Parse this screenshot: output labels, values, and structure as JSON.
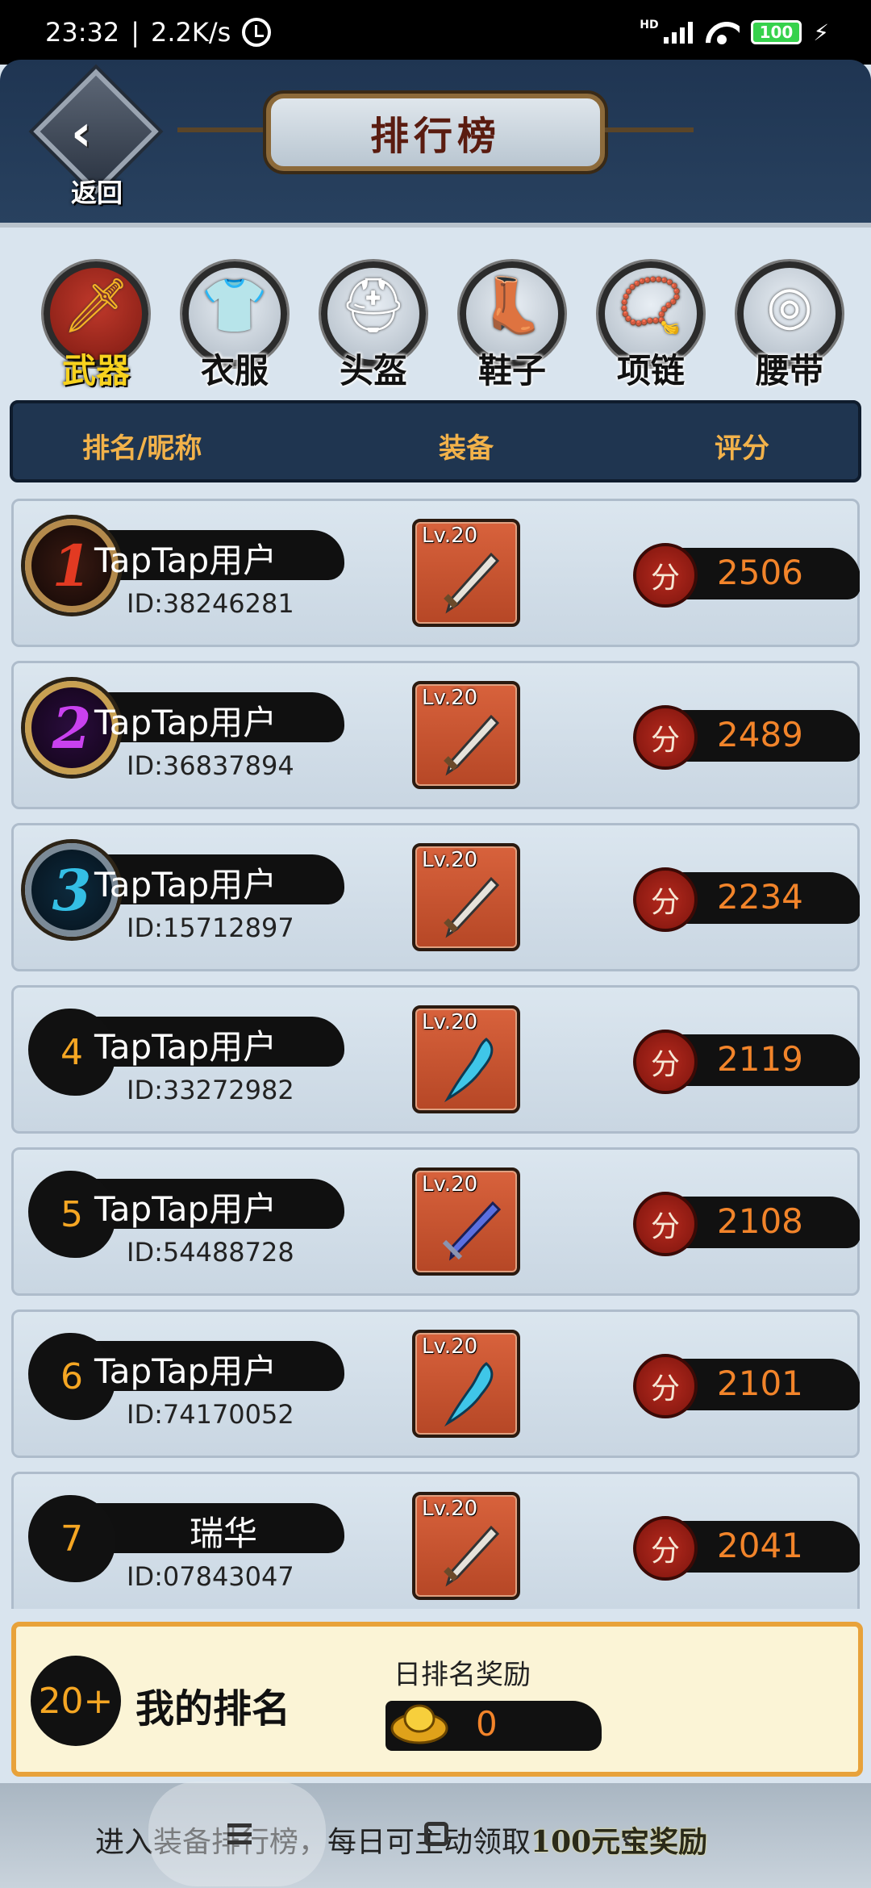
{
  "status_bar": {
    "time": "23:32",
    "net_speed": "2.2K/s",
    "hd": "HD",
    "battery": "100"
  },
  "header": {
    "back_label": "返回",
    "title": "排行榜"
  },
  "tabs": [
    {
      "label": "武器",
      "icon": "sword-icon",
      "glyph": "🗡",
      "active": true
    },
    {
      "label": "衣服",
      "icon": "armor-icon",
      "glyph": "👕",
      "active": false
    },
    {
      "label": "头盔",
      "icon": "helmet-icon",
      "glyph": "⛑",
      "active": false
    },
    {
      "label": "鞋子",
      "icon": "boot-icon",
      "glyph": "👢",
      "active": false
    },
    {
      "label": "项链",
      "icon": "necklace-icon",
      "glyph": "📿",
      "active": false
    },
    {
      "label": "腰带",
      "icon": "belt-icon",
      "glyph": "◎",
      "active": false
    }
  ],
  "columns": {
    "rank": "排名/昵称",
    "equip": "装备",
    "score": "评分"
  },
  "score_seal": "分",
  "rows": [
    {
      "rank": "1",
      "name": "TapTap用户",
      "id": "ID:38246281",
      "level": "Lv.20",
      "score": "2506"
    },
    {
      "rank": "2",
      "name": "TapTap用户",
      "id": "ID:36837894",
      "level": "Lv.20",
      "score": "2489"
    },
    {
      "rank": "3",
      "name": "TapTap用户",
      "id": "ID:15712897",
      "level": "Lv.20",
      "score": "2234"
    },
    {
      "rank": "4",
      "name": "TapTap用户",
      "id": "ID:33272982",
      "level": "Lv.20",
      "score": "2119"
    },
    {
      "rank": "5",
      "name": "TapTap用户",
      "id": "ID:54488728",
      "level": "Lv.20",
      "score": "2108"
    },
    {
      "rank": "6",
      "name": "TapTap用户",
      "id": "ID:74170052",
      "level": "Lv.20",
      "score": "2101"
    },
    {
      "rank": "7",
      "name": "瑞华",
      "id": "ID:07843047",
      "level": "Lv.20",
      "score": "2041"
    }
  ],
  "my_rank": {
    "rank": "20+",
    "label": "我的排名",
    "reward_title": "日排名奖励",
    "reward_value": "0"
  },
  "notice": {
    "text": "进入装备排行榜，每日可主动领取",
    "highlight": "100元宝奖励"
  },
  "colors": {
    "header_bg": "#1f3552",
    "accent_orange": "#f2842a",
    "gold_text": "#f2b24a",
    "my_rank_border": "#e8a23a"
  }
}
